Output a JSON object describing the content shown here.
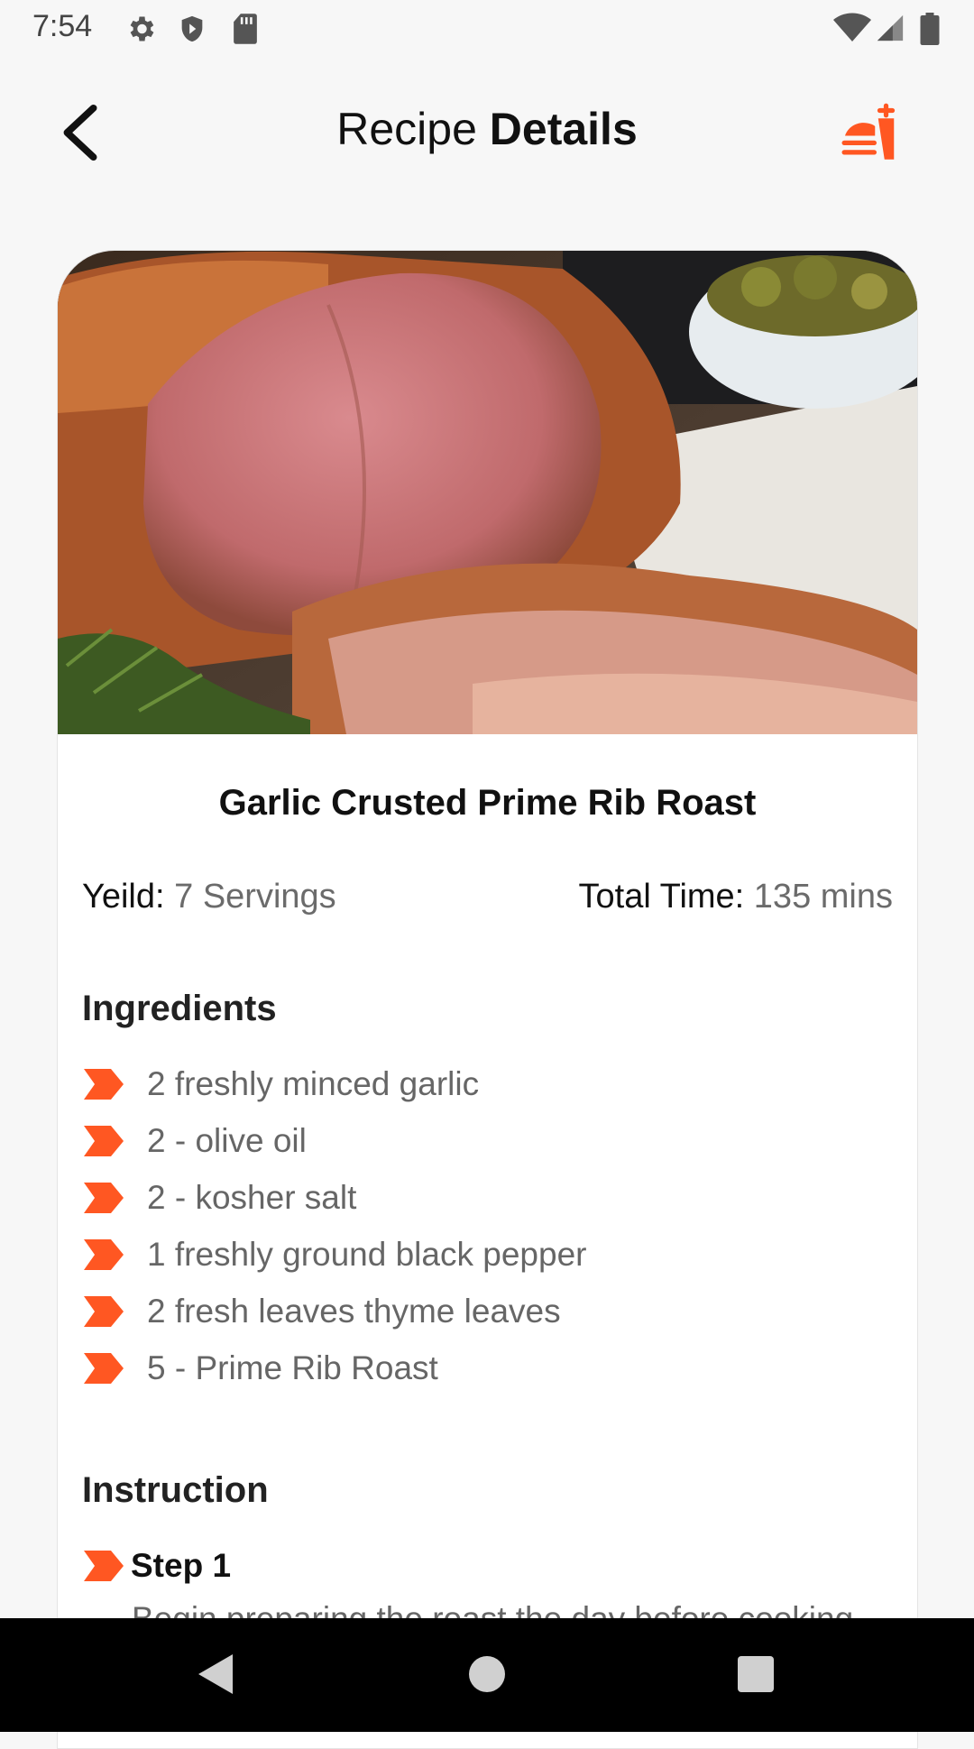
{
  "status_bar": {
    "time": "7:54",
    "icons": [
      "settings-icon",
      "shield-icon",
      "sd-card-icon",
      "wifi-icon",
      "signal-icon",
      "battery-icon"
    ]
  },
  "app_bar": {
    "title_regular": "Recipe",
    "title_bold": "Details",
    "back_icon": "chevron-left-icon",
    "logo_icon": "food-app-icon"
  },
  "colors": {
    "accent": "#ff5722",
    "muted_text": "#6b6b6b",
    "background": "#f7f7f7"
  },
  "recipe": {
    "name": "Garlic Crusted Prime Rib Roast",
    "yield_label": "Yeild:",
    "yield_value": "7 Servings",
    "time_label": "Total Time:",
    "time_value": "135 mins",
    "ingredients_title": "Ingredients",
    "ingredients": [
      "2 freshly minced garlic",
      "2 - olive oil",
      "2 - kosher salt",
      "1 freshly ground black pepper",
      "2 fresh leaves thyme leaves",
      "5 - Prime Rib Roast"
    ],
    "instruction_title": "Instruction",
    "steps": [
      {
        "label": "Step 1",
        "text": "Begin preparing the roast the day before cooking"
      }
    ]
  },
  "nav_bar": {
    "icons": [
      "back-triangle-icon",
      "home-circle-icon",
      "recents-square-icon"
    ]
  }
}
